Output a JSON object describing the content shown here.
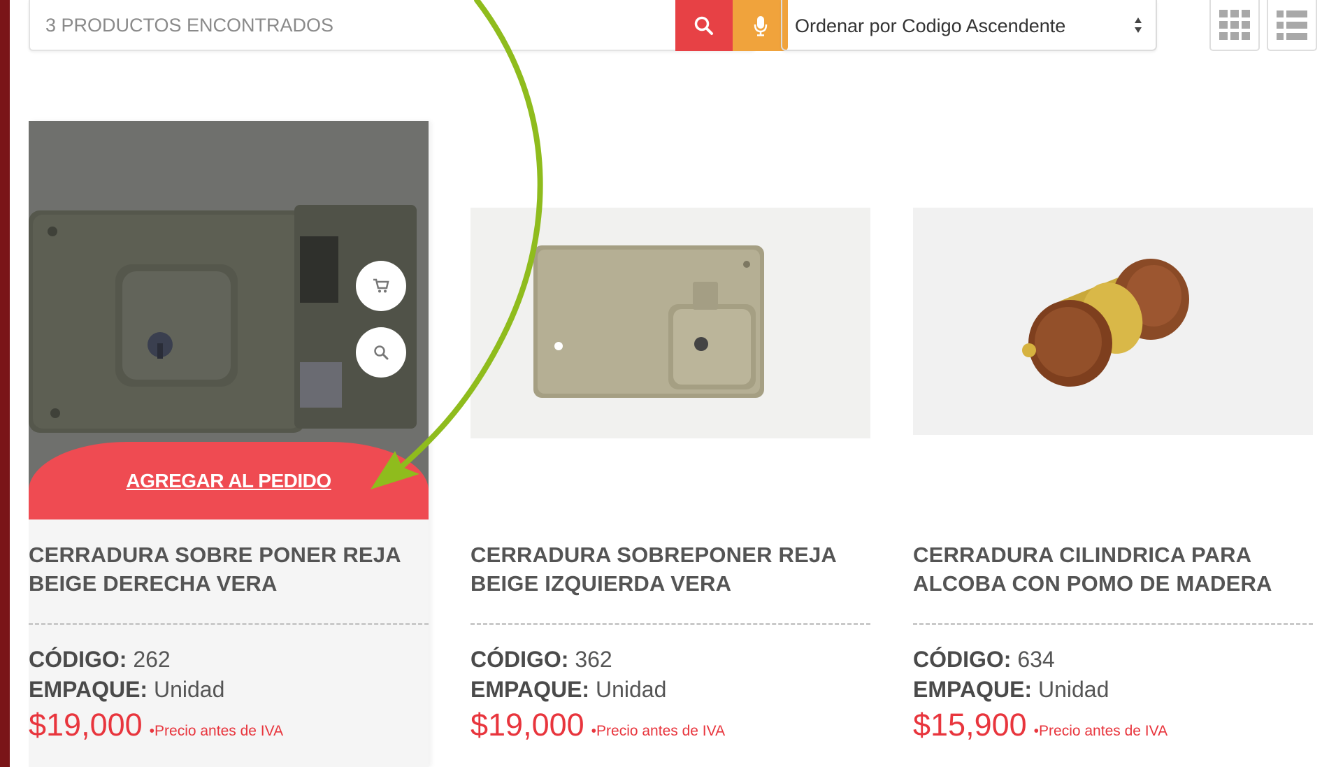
{
  "search": {
    "placeholder": "3 PRODUCTOS ENCONTRADOS",
    "search_icon": "search-icon",
    "mic_icon": "microphone-icon",
    "search_color": "#e74145",
    "mic_color": "#f0a33c"
  },
  "sort": {
    "selected": "Ordenar por Codigo Ascendente"
  },
  "view_toggle": {
    "grid_icon": "grid-view-icon",
    "list_icon": "list-view-icon"
  },
  "overlay": {
    "cart_icon": "cart-icon",
    "zoom_icon": "search-icon",
    "add_label": "AGREGAR AL PEDIDO"
  },
  "labels": {
    "code": "CÓDIGO:",
    "package": "EMPAQUE:",
    "price_note": "•Precio antes de IVA"
  },
  "products": [
    {
      "title_line1": "CERRADURA SOBRE PONER REJA",
      "title_line2": "BEIGE DERECHA VERA",
      "code": "262",
      "package": "Unidad",
      "price": "$19,000"
    },
    {
      "title_line1": "CERRADURA SOBREPONER REJA",
      "title_line2": "BEIGE IZQUIERDA VERA",
      "code": "362",
      "package": "Unidad",
      "price": "$19,000"
    },
    {
      "title_line1": "CERRADURA CILINDRICA PARA",
      "title_line2": "ALCOBA CON POMO DE MADERA",
      "code": "634",
      "package": "Unidad",
      "price": "$15,900"
    }
  ],
  "colors": {
    "accent_red": "#e8353d",
    "annotation_arrow": "#8fbc1d",
    "left_stripe": "#7a1518"
  }
}
